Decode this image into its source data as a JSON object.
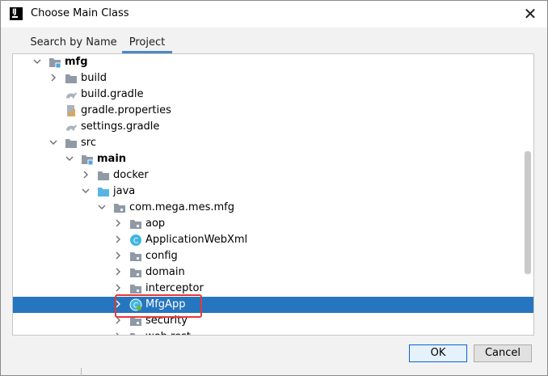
{
  "window": {
    "title": "Choose Main Class",
    "close_glyph": "✕"
  },
  "tabs": [
    {
      "label": "Search by Name",
      "active": false
    },
    {
      "label": "Project",
      "active": true
    }
  ],
  "tree": [
    {
      "label": "mfg",
      "depth": 0,
      "expanded": true,
      "icon": "module-folder-icon",
      "bold": true,
      "selected": false
    },
    {
      "label": "build",
      "depth": 1,
      "expanded": false,
      "icon": "folder-icon",
      "bold": false,
      "selected": false
    },
    {
      "label": "build.gradle",
      "depth": 1,
      "expanded": null,
      "icon": "gradle-icon",
      "bold": false,
      "selected": false
    },
    {
      "label": "gradle.properties",
      "depth": 1,
      "expanded": null,
      "icon": "properties-icon",
      "bold": false,
      "selected": false
    },
    {
      "label": "settings.gradle",
      "depth": 1,
      "expanded": null,
      "icon": "gradle-icon",
      "bold": false,
      "selected": false
    },
    {
      "label": "src",
      "depth": 1,
      "expanded": true,
      "icon": "folder-icon",
      "bold": false,
      "selected": false
    },
    {
      "label": "main",
      "depth": 2,
      "expanded": true,
      "icon": "module-folder-icon",
      "bold": true,
      "selected": false
    },
    {
      "label": "docker",
      "depth": 3,
      "expanded": false,
      "icon": "folder-icon",
      "bold": false,
      "selected": false
    },
    {
      "label": "java",
      "depth": 3,
      "expanded": true,
      "icon": "source-folder-icon",
      "bold": false,
      "selected": false
    },
    {
      "label": "com.mega.mes.mfg",
      "depth": 4,
      "expanded": true,
      "icon": "package-icon",
      "bold": false,
      "selected": false
    },
    {
      "label": "aop",
      "depth": 5,
      "expanded": false,
      "icon": "package-icon",
      "bold": false,
      "selected": false
    },
    {
      "label": "ApplicationWebXml",
      "depth": 5,
      "expanded": false,
      "icon": "class-icon",
      "bold": false,
      "selected": false
    },
    {
      "label": "config",
      "depth": 5,
      "expanded": false,
      "icon": "package-icon",
      "bold": false,
      "selected": false
    },
    {
      "label": "domain",
      "depth": 5,
      "expanded": false,
      "icon": "package-icon",
      "bold": false,
      "selected": false
    },
    {
      "label": "interceptor",
      "depth": 5,
      "expanded": false,
      "icon": "package-icon",
      "bold": false,
      "selected": false
    },
    {
      "label": "MfgApp",
      "depth": 5,
      "expanded": false,
      "icon": "spring-class-icon",
      "bold": false,
      "selected": true
    },
    {
      "label": "security",
      "depth": 5,
      "expanded": false,
      "icon": "package-icon",
      "bold": false,
      "selected": false
    },
    {
      "label": "web.rest",
      "depth": 5,
      "expanded": false,
      "icon": "package-icon",
      "bold": false,
      "selected": false
    }
  ],
  "buttons": {
    "ok": "OK",
    "cancel": "Cancel"
  },
  "colors": {
    "selection": "#2675bf",
    "highlight_box": "#e53935",
    "accent": "#4a88c7"
  }
}
